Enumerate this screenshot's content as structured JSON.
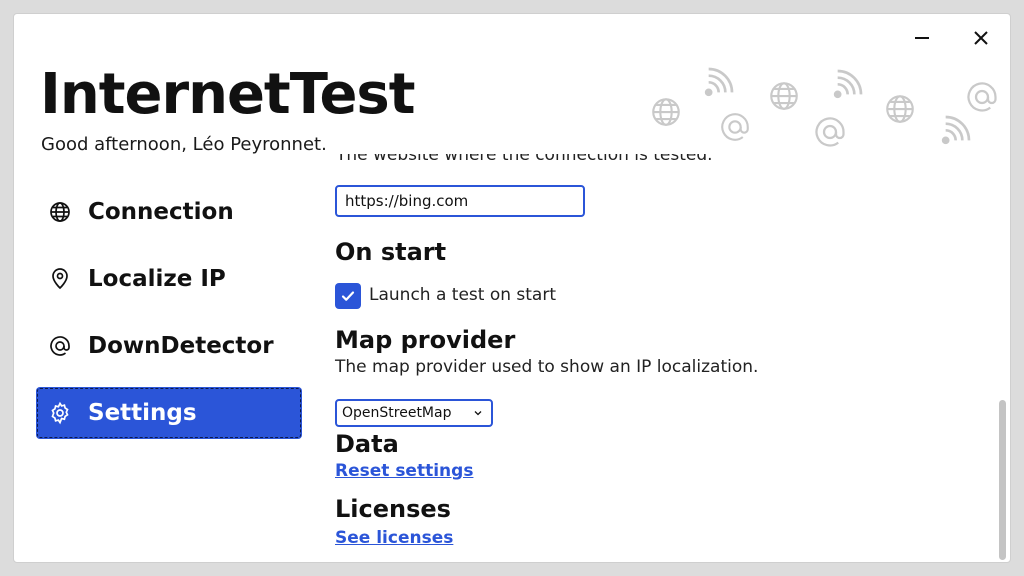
{
  "window": {
    "minimize_icon": "minimize-icon",
    "close_icon": "close-icon"
  },
  "header": {
    "title": "InternetTest",
    "greeting": "Good afternoon, Léo Peyronnet."
  },
  "sidebar": {
    "items": [
      {
        "label": "Connection",
        "icon": "globe-icon",
        "active": false
      },
      {
        "label": "Localize IP",
        "icon": "location-pin-icon",
        "active": false
      },
      {
        "label": "DownDetector",
        "icon": "at-sign-icon",
        "active": false
      },
      {
        "label": "Settings",
        "icon": "gear-icon",
        "active": true
      }
    ]
  },
  "settings": {
    "test_site": {
      "description": "The website where the connection is tested.",
      "value": "https://bing.com"
    },
    "on_start": {
      "title": "On start",
      "checkbox_label": "Launch a test on start",
      "checked": true
    },
    "map_provider": {
      "title": "Map provider",
      "description": "The map provider used to show an IP localization.",
      "selected": "OpenStreetMap"
    },
    "data": {
      "title": "Data",
      "link": "Reset settings"
    },
    "licenses": {
      "title": "Licenses",
      "link": "See licenses"
    }
  },
  "colors": {
    "accent": "#2b55d8",
    "decoration": "#c9c9c9"
  }
}
